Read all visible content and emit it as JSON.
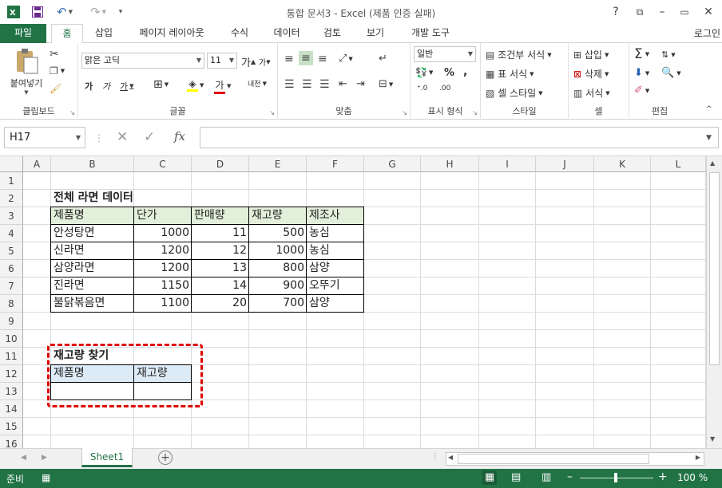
{
  "app": {
    "title": "통합 문서3 - Excel (제품 인증 실패)"
  },
  "tabs": [
    "파일",
    "홈",
    "삽입",
    "페이지 레이아웃",
    "수식",
    "데이터",
    "검토",
    "보기",
    "개발 도구"
  ],
  "login": "로그인",
  "ribbon": {
    "clipboard": {
      "paste": "붙여넣기",
      "label": "클립보드"
    },
    "font": {
      "name": "맑은 고딕",
      "size": "11",
      "bold": "가",
      "italic": "가",
      "underline": "가",
      "grow": "가",
      "shrink": "가",
      "color_char": "가",
      "phonetic": "내천",
      "label": "글꼴"
    },
    "align": {
      "label": "맞춤"
    },
    "number": {
      "format": "일반",
      "percent": "%",
      "comma": ",",
      "label": "표시 형식"
    },
    "styles": {
      "conditional": "조건부 서식",
      "table": "표 서식",
      "cell": "셀 스타일",
      "label": "스타일"
    },
    "cells": {
      "insert": "삽입",
      "delete": "삭제",
      "format": "서식",
      "label": "셀"
    },
    "edit": {
      "label": "편집"
    }
  },
  "formula_bar": {
    "name_box": "H17",
    "fx": "fx",
    "value": ""
  },
  "columns": [
    "A",
    "B",
    "C",
    "D",
    "E",
    "F",
    "G",
    "H",
    "I",
    "J",
    "K",
    "L"
  ],
  "rows": [
    "1",
    "2",
    "3",
    "4",
    "5",
    "6",
    "7",
    "8",
    "9",
    "10",
    "11",
    "12",
    "13",
    "14",
    "15",
    "16"
  ],
  "sheet": {
    "table1_title": "전체 라면 데이터",
    "table1_headers": [
      "제품명",
      "단가",
      "판매량",
      "재고량",
      "제조사"
    ],
    "table1_rows": [
      [
        "안성탕면",
        "1000",
        "11",
        "500",
        "농심"
      ],
      [
        "신라면",
        "1200",
        "12",
        "1000",
        "농심"
      ],
      [
        "삼양라면",
        "1200",
        "13",
        "800",
        "삼양"
      ],
      [
        "진라면",
        "1150",
        "14",
        "900",
        "오뚜기"
      ],
      [
        "불닭볶음면",
        "1100",
        "20",
        "700",
        "삼양"
      ]
    ],
    "table2_title": "재고량 찾기",
    "table2_headers": [
      "제품명",
      "재고량"
    ],
    "header_fill": "#e2efda",
    "lookup_header_fill": "#ddebf7",
    "highlight_color": "#e00000"
  },
  "sheet_tabs": [
    "Sheet1"
  ],
  "status": {
    "mode": "준비",
    "zoom": "100 %"
  },
  "colors": {
    "excel_green": "#217346"
  }
}
